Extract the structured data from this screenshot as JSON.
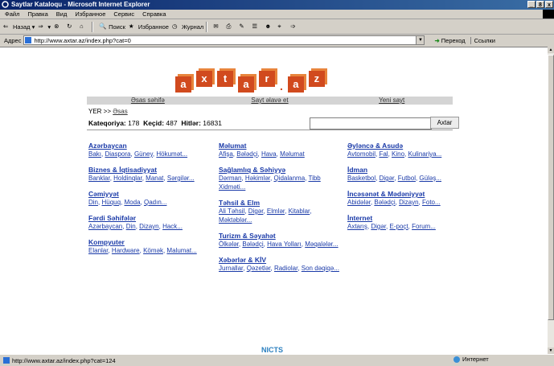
{
  "window": {
    "title": "Saytlar Kataloqu - Microsoft Internet Explorer",
    "controls": [
      "_",
      "8",
      "x"
    ]
  },
  "menu": [
    "Файл",
    "Правка",
    "Вид",
    "Избранное",
    "Сервис",
    "Справка"
  ],
  "toolbar": {
    "back": "Назад",
    "search": "Поиск",
    "favorites": "Избранное",
    "history": "Журнал"
  },
  "address": {
    "label": "Адрес",
    "url": "http://www.axtar.az/index.php?cat=0",
    "go": "Переход",
    "links": "Ссылки"
  },
  "site": {
    "logo_letters": [
      "a",
      "x",
      "t",
      "a",
      "r",
      ".",
      "a",
      "z"
    ],
    "nav": [
      "Əsas səhifə",
      "Sayt əlavə et",
      "Yeni sayt"
    ],
    "breadcrumb": {
      "prefix": "YER >> ",
      "link": "Əsas"
    },
    "stats": {
      "categories_label": "Kateqoriya:",
      "categories": "178",
      "links_label": "Keçid:",
      "links": "487",
      "hits_label": "Hitlər:",
      "hits": "16831"
    },
    "search_button": "Axtar",
    "columns": [
      [
        {
          "title": "Azərbaycan",
          "sub": [
            "Bakı",
            "Diaspora",
            "Güney",
            "Hökumət..."
          ]
        },
        {
          "title": "Biznes & İqtisadiyyat",
          "sub": [
            "Banklar",
            "Holdinqlar",
            "Manat",
            "Sərgilər..."
          ]
        },
        {
          "title": "Cəmiyyət",
          "sub": [
            "Din",
            "Hüquq",
            "Moda",
            "Qadın..."
          ]
        },
        {
          "title": "Fərdi Səhifələr",
          "sub": [
            "Azərbaycan",
            "Din",
            "Dizayn",
            "Hack..."
          ]
        },
        {
          "title": "Kompyuter",
          "sub": [
            "Elanlar",
            "Hardware",
            "Kömək",
            "Malumat..."
          ]
        }
      ],
      [
        {
          "title": "Məlumat",
          "sub": [
            "Afişa",
            "Bələdçi",
            "Hava",
            "Məlumat"
          ]
        },
        {
          "title": "Sağlamlıq & Səhiyyə",
          "sub": [
            "Dərman",
            "Həkimlər",
            "Qidalanma",
            "Tibb Xidməti..."
          ]
        },
        {
          "title": "Təhsil & Elm",
          "sub": [
            "Ali Təhsil",
            "Digər",
            "Elmlər",
            "Kitablar",
            "Məktəblər..."
          ]
        },
        {
          "title": "Turizm & Səyahət",
          "sub": [
            "Ölkələr",
            "Bələdçi",
            "Hava Yolları",
            "Məqalələr..."
          ]
        },
        {
          "title": "Xəbərlər & KİV",
          "sub": [
            "Jurnallar",
            "Qəzetlər",
            "Radiolar",
            "Son dəqiqə..."
          ]
        }
      ],
      [
        {
          "title": "Əyləncə & Asudə",
          "sub": [
            "Avtomobil",
            "Fal",
            "Kino",
            "Kulinariya..."
          ]
        },
        {
          "title": "İdman",
          "sub": [
            "Basketbol",
            "Digər",
            "Futbol",
            "Güləş..."
          ]
        },
        {
          "title": "İncəsənət & Mədəniyyət",
          "sub": [
            "Abidələr",
            "Bələdçi",
            "Dizayn",
            "Foto..."
          ]
        },
        {
          "title": "İnternet",
          "sub": [
            "Axtarış",
            "Digər",
            "E-poçt",
            "Forum..."
          ]
        }
      ]
    ],
    "footer_logo": "NICTS"
  },
  "status": {
    "url": "http://www.axtar.az/index.php?cat=124",
    "zone": "Интернет"
  }
}
